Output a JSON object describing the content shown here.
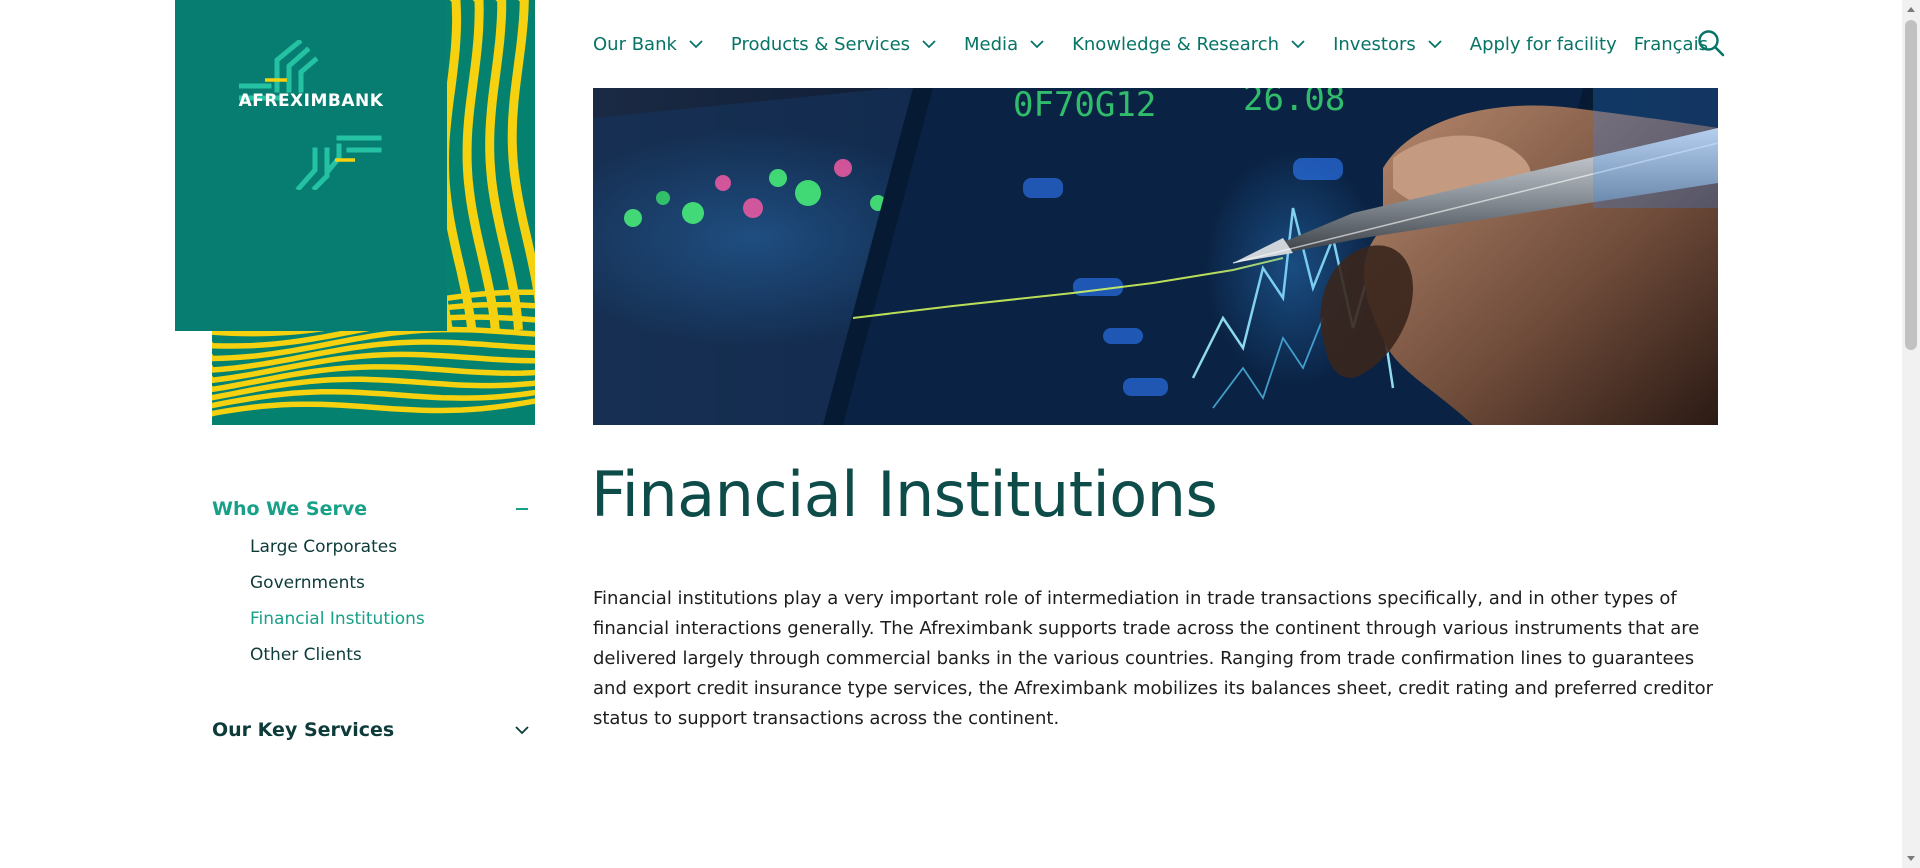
{
  "brand": {
    "name": "AFREXIMBANK",
    "colors": {
      "green": "#077d71",
      "yellow": "#f5d10f",
      "accent": "#18a088",
      "dark": "#0d3b3a"
    }
  },
  "nav": {
    "items": [
      {
        "label": "Our Bank",
        "has_menu": true,
        "icon": "chevron-down-icon"
      },
      {
        "label": "Products & Services",
        "has_menu": true,
        "icon": "chevron-down-icon"
      },
      {
        "label": "Media",
        "has_menu": true,
        "icon": "chevron-down-icon"
      },
      {
        "label": "Knowledge & Research",
        "has_menu": true,
        "icon": "chevron-down-icon"
      },
      {
        "label": "Investors",
        "has_menu": true,
        "icon": "chevron-down-icon"
      },
      {
        "label": "Apply for facility",
        "has_menu": false
      },
      {
        "label": "Français",
        "has_menu": false
      }
    ],
    "search_icon": "search-icon"
  },
  "sidebar": {
    "sections": [
      {
        "title": "Who We Serve",
        "state": "expanded",
        "toggle_icon": "minus-icon",
        "items": [
          {
            "label": "Large Corporates",
            "active": false
          },
          {
            "label": "Governments",
            "active": false
          },
          {
            "label": "Financial Institutions",
            "active": true
          },
          {
            "label": "Other Clients",
            "active": false
          }
        ]
      },
      {
        "title": "Our Key Services",
        "state": "collapsed",
        "toggle_icon": "chevron-down-icon"
      }
    ]
  },
  "main": {
    "title": "Financial Institutions",
    "body": "Financial institutions play a very important role of intermediation in trade transactions specifically, and in other types of financial interactions generally. The Afreximbank supports trade across the continent through various instruments that are delivered largely through commercial banks in the various countries. Ranging from trade confirmation lines to guarantees and export credit insurance type services, the Afreximbank mobilizes its balances sheet, credit rating and preferred creditor status to support transactions across the continent."
  }
}
